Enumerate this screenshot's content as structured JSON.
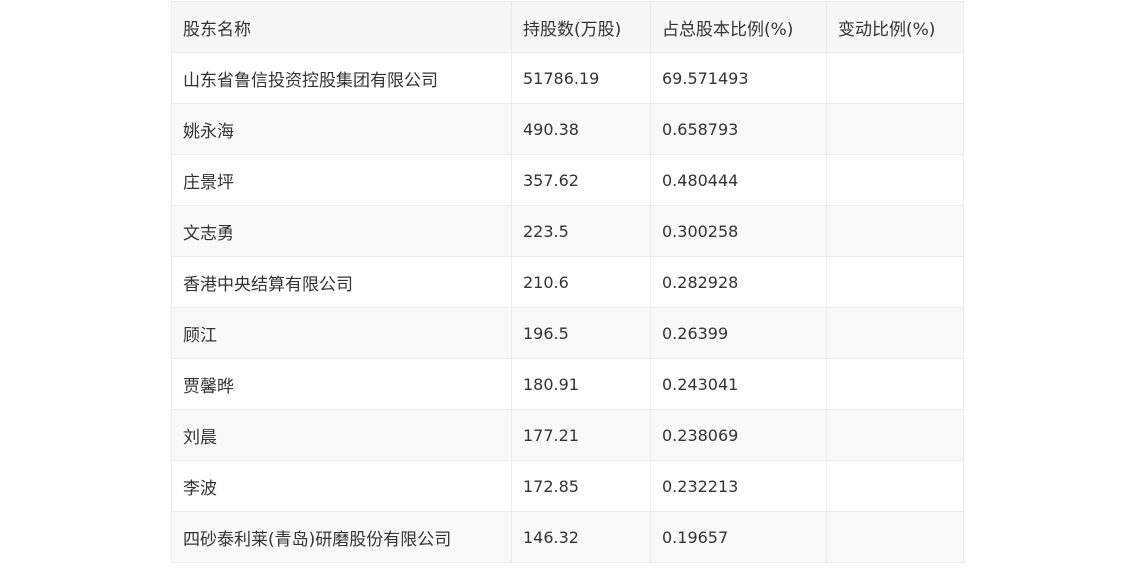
{
  "table": {
    "headers": [
      "股东名称",
      "持股数(万股)",
      "占总股本比例(%)",
      "变动比例(%)"
    ],
    "rows": [
      [
        "山东省鲁信投资控股集团有限公司",
        "51786.19",
        "69.571493",
        ""
      ],
      [
        "姚永海",
        "490.38",
        "0.658793",
        ""
      ],
      [
        "庄景坪",
        "357.62",
        "0.480444",
        ""
      ],
      [
        "文志勇",
        "223.5",
        "0.300258",
        ""
      ],
      [
        "香港中央结算有限公司",
        "210.6",
        "0.282928",
        ""
      ],
      [
        "顾江",
        "196.5",
        "0.26399",
        ""
      ],
      [
        "贾馨晔",
        "180.91",
        "0.243041",
        ""
      ],
      [
        "刘晨",
        "177.21",
        "0.238069",
        ""
      ],
      [
        "李波",
        "172.85",
        "0.232213",
        ""
      ],
      [
        "四砂泰利莱(青岛)研磨股份有限公司",
        "146.32",
        "0.19657",
        ""
      ]
    ]
  }
}
